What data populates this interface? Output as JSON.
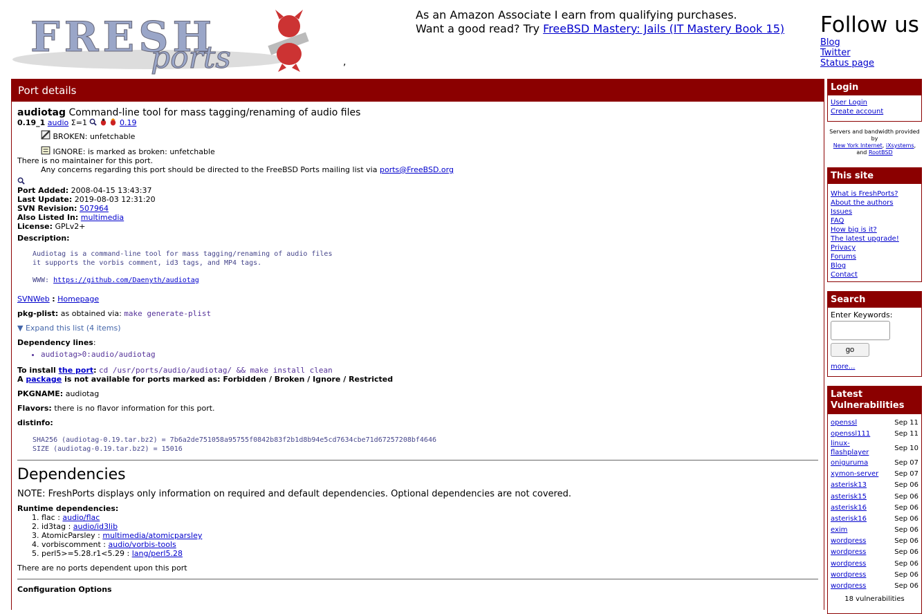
{
  "header": {
    "logo_text_1": "FRESH",
    "logo_text_2": "ports",
    "ad_line1": "As an Amazon Associate I earn from qualifying purchases.",
    "ad_line2_prefix": "Want a good read? Try ",
    "ad_link": "FreeBSD Mastery: Jails (IT Mastery Book 15)",
    "follow_title": "Follow us",
    "follow_links": [
      "Blog",
      "Twitter",
      "Status page"
    ]
  },
  "main": {
    "bar_title": "Port details",
    "port_name": "audiotag",
    "port_desc": "Command-line tool for mass tagging/renaming of audio files",
    "version": "0.19_1",
    "category": "audio",
    "sigma": "Σ=1",
    "version_link": "0.19",
    "broken": "BROKEN: unfetchable",
    "ignore": "IGNORE: is marked as broken: unfetchable",
    "no_maintainer": "There is no maintainer for this port.",
    "concerns": "Any concerns regarding this port should be directed to the FreeBSD Ports mailing list via ",
    "mail_link": "ports@FreeBSD.org",
    "port_added_label": "Port Added:",
    "port_added": "2008-04-15 13:43:37",
    "last_update_label": "Last Update:",
    "last_update": "2019-08-03 12:31:20",
    "svn_label": "SVN Revision:",
    "svn": "507964",
    "listed_label": "Also Listed In:",
    "listed": "multimedia",
    "license_label": "License:",
    "license": "GPLv2+",
    "description_label": "Description:",
    "desc_line1": "Audiotag is a command-line tool for mass tagging/renaming of audio files",
    "desc_line2": "it supports the vorbis comment, id3 tags, and MP4 tags.",
    "www_label": "WWW: ",
    "www_link": "https://github.com/Daenyth/audiotag",
    "svnweb": "SVNWeb",
    "homepage": "Homepage",
    "pkgplist_label": "pkg-plist:",
    "pkgplist_text": "as obtained via: ",
    "pkgplist_cmd": "make generate-plist",
    "expand": "Expand this list (4 items)",
    "deplines_label": "Dependency lines",
    "depline": "audiotag>0:audio/audiotag",
    "install_label": "To install ",
    "the_port": "the port",
    "install_cmd": "cd /usr/ports/audio/audiotag/ && make install clean",
    "package_a": "A ",
    "package_link": "package",
    "package_rest": " is not available for ports marked as: Forbidden / Broken / Ignore / Restricted",
    "pkgname_label": "PKGNAME:",
    "pkgname": "audiotag",
    "flavors_label": "Flavors:",
    "flavors": "there is no flavor information for this port.",
    "distinfo_label": "distinfo:",
    "sha256": "SHA256 (audiotag-0.19.tar.bz2) = 7b6a2de751058a95755f0842b83f2b1d8b94e5cd7634cbe71d67257208bf4646",
    "size": "SIZE (audiotag-0.19.tar.bz2) = 15016",
    "deps_title": "Dependencies",
    "deps_note": "NOTE: FreshPorts displays only information on required and default dependencies. Optional dependencies are not covered.",
    "runtime_label": "Runtime dependencies:",
    "runtime": [
      {
        "name": "flac : ",
        "link": "audio/flac"
      },
      {
        "name": "id3tag : ",
        "link": "audio/id3lib"
      },
      {
        "name": "AtomicParsley : ",
        "link": "multimedia/atomicparsley"
      },
      {
        "name": "vorbiscomment : ",
        "link": "audio/vorbis-tools"
      },
      {
        "name": "perl5>=5.28.r1<5.29 : ",
        "link": "lang/perl5.28"
      }
    ],
    "no_dependents": "There are no ports dependent upon this port",
    "config_label": "Configuration Options"
  },
  "sidebar": {
    "login_title": "Login",
    "login_links": [
      "User Login",
      "Create account"
    ],
    "provided_text": "Servers and bandwidth provided by",
    "provided_links": [
      "New York Internet",
      "iXsystems",
      "RootBSD"
    ],
    "provided_and": "and",
    "site_title": "This site",
    "site_links": [
      "What is FreshPorts?",
      "About the authors",
      "Issues",
      "FAQ",
      "How big is it?",
      "The latest upgrade!",
      "Privacy",
      "Forums",
      "Blog",
      "Contact"
    ],
    "search_title": "Search",
    "search_label": "Enter Keywords:",
    "go_label": "go",
    "more_label": "more...",
    "vuln_title": "Latest Vulnerabilities",
    "vulns": [
      {
        "name": "openssl",
        "date": "Sep 11"
      },
      {
        "name": "openssl111",
        "date": "Sep 11"
      },
      {
        "name": "linux-flashplayer",
        "date": "Sep 10"
      },
      {
        "name": "oniguruma",
        "date": "Sep 07"
      },
      {
        "name": "xymon-server",
        "date": "Sep 07"
      },
      {
        "name": "asterisk13",
        "date": "Sep 06"
      },
      {
        "name": "asterisk15",
        "date": "Sep 06"
      },
      {
        "name": "asterisk16",
        "date": "Sep 06"
      },
      {
        "name": "asterisk16",
        "date": "Sep 06"
      },
      {
        "name": "exim",
        "date": "Sep 06"
      },
      {
        "name": "wordpress",
        "date": "Sep 06"
      },
      {
        "name": "wordpress",
        "date": "Sep 06"
      },
      {
        "name": "wordpress",
        "date": "Sep 06"
      },
      {
        "name": "wordpress",
        "date": "Sep 06"
      },
      {
        "name": "wordpress",
        "date": "Sep 06"
      }
    ],
    "vuln_count": "18 vulnerabilities"
  },
  "colors": {
    "brand": "#8b0000",
    "link": "#0000cc",
    "mono": "#553399"
  }
}
